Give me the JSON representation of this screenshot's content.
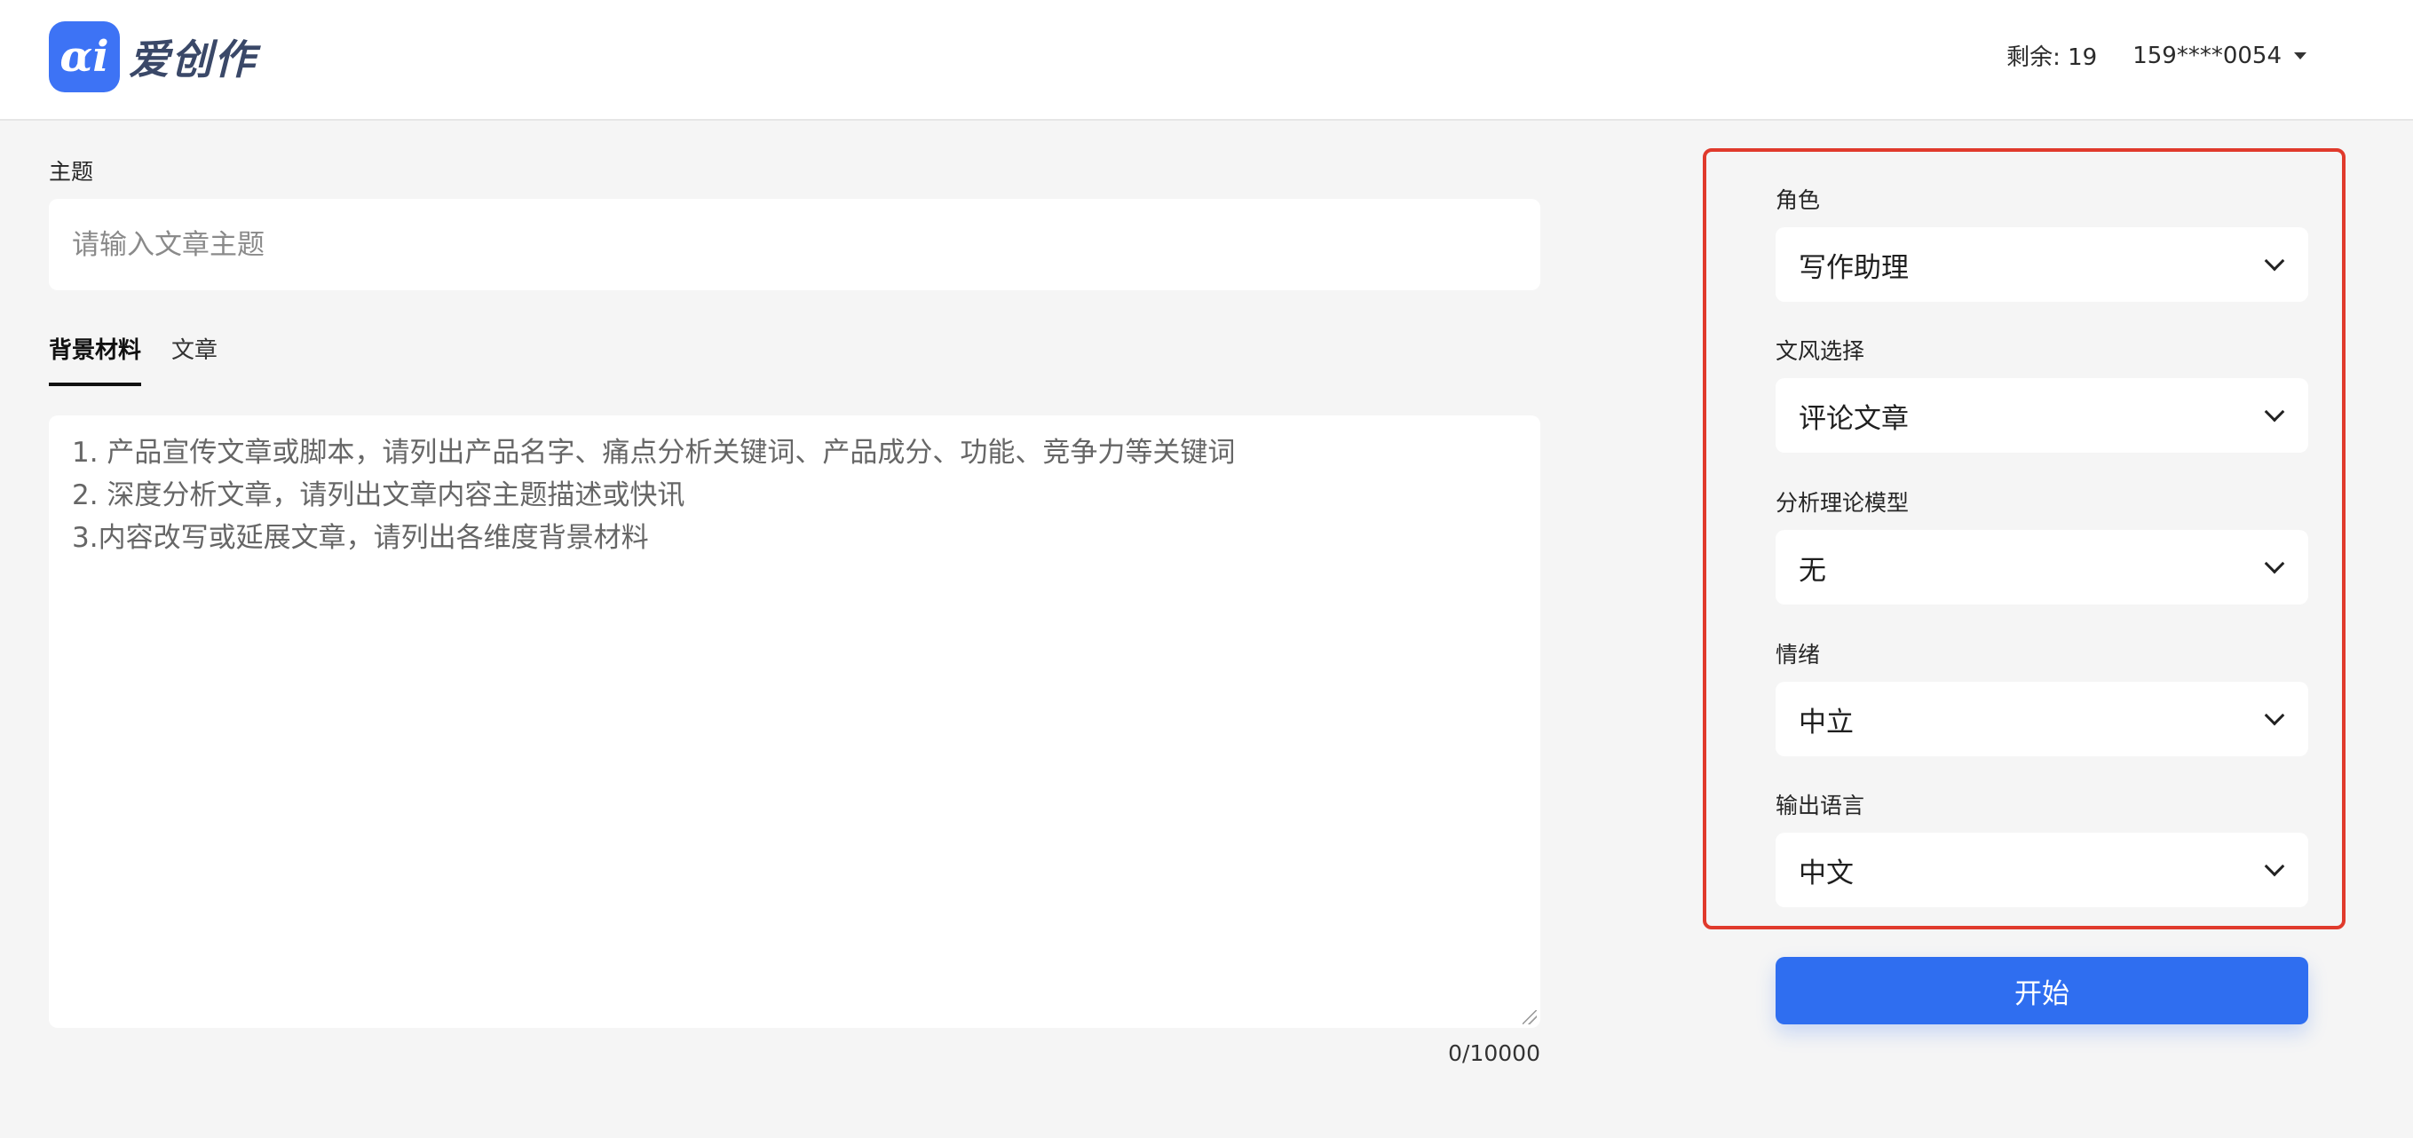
{
  "header": {
    "logo_mark": "αi",
    "brand": "爱创作",
    "remaining": "剩余: 19",
    "user": "159****0054"
  },
  "topic": {
    "label": "主题",
    "placeholder": "请输入文章主题",
    "value": ""
  },
  "tabs": [
    {
      "label": "背景材料",
      "active": true
    },
    {
      "label": "文章",
      "active": false
    }
  ],
  "material": {
    "lines": [
      "1. 产品宣传文章或脚本，请列出产品名字、痛点分析关键词、产品成分、功能、竞争力等关键词",
      "2. 深度分析文章，请列出文章内容主题描述或快讯",
      "3.内容改写或延展文章，请列出各维度背景材料"
    ],
    "counter": "0/10000"
  },
  "settings": {
    "role": {
      "label": "角色",
      "value": "写作助理"
    },
    "style": {
      "label": "文风选择",
      "value": "评论文章"
    },
    "model": {
      "label": "分析理论模型",
      "value": "无"
    },
    "emotion": {
      "label": "情绪",
      "value": "中立"
    },
    "language": {
      "label": "输出语言",
      "value": "中文"
    }
  },
  "start_label": "开始",
  "colors": {
    "accent": "#2f6ef0",
    "highlight_border": "#e03a2c",
    "logo": "#3d73f5"
  }
}
